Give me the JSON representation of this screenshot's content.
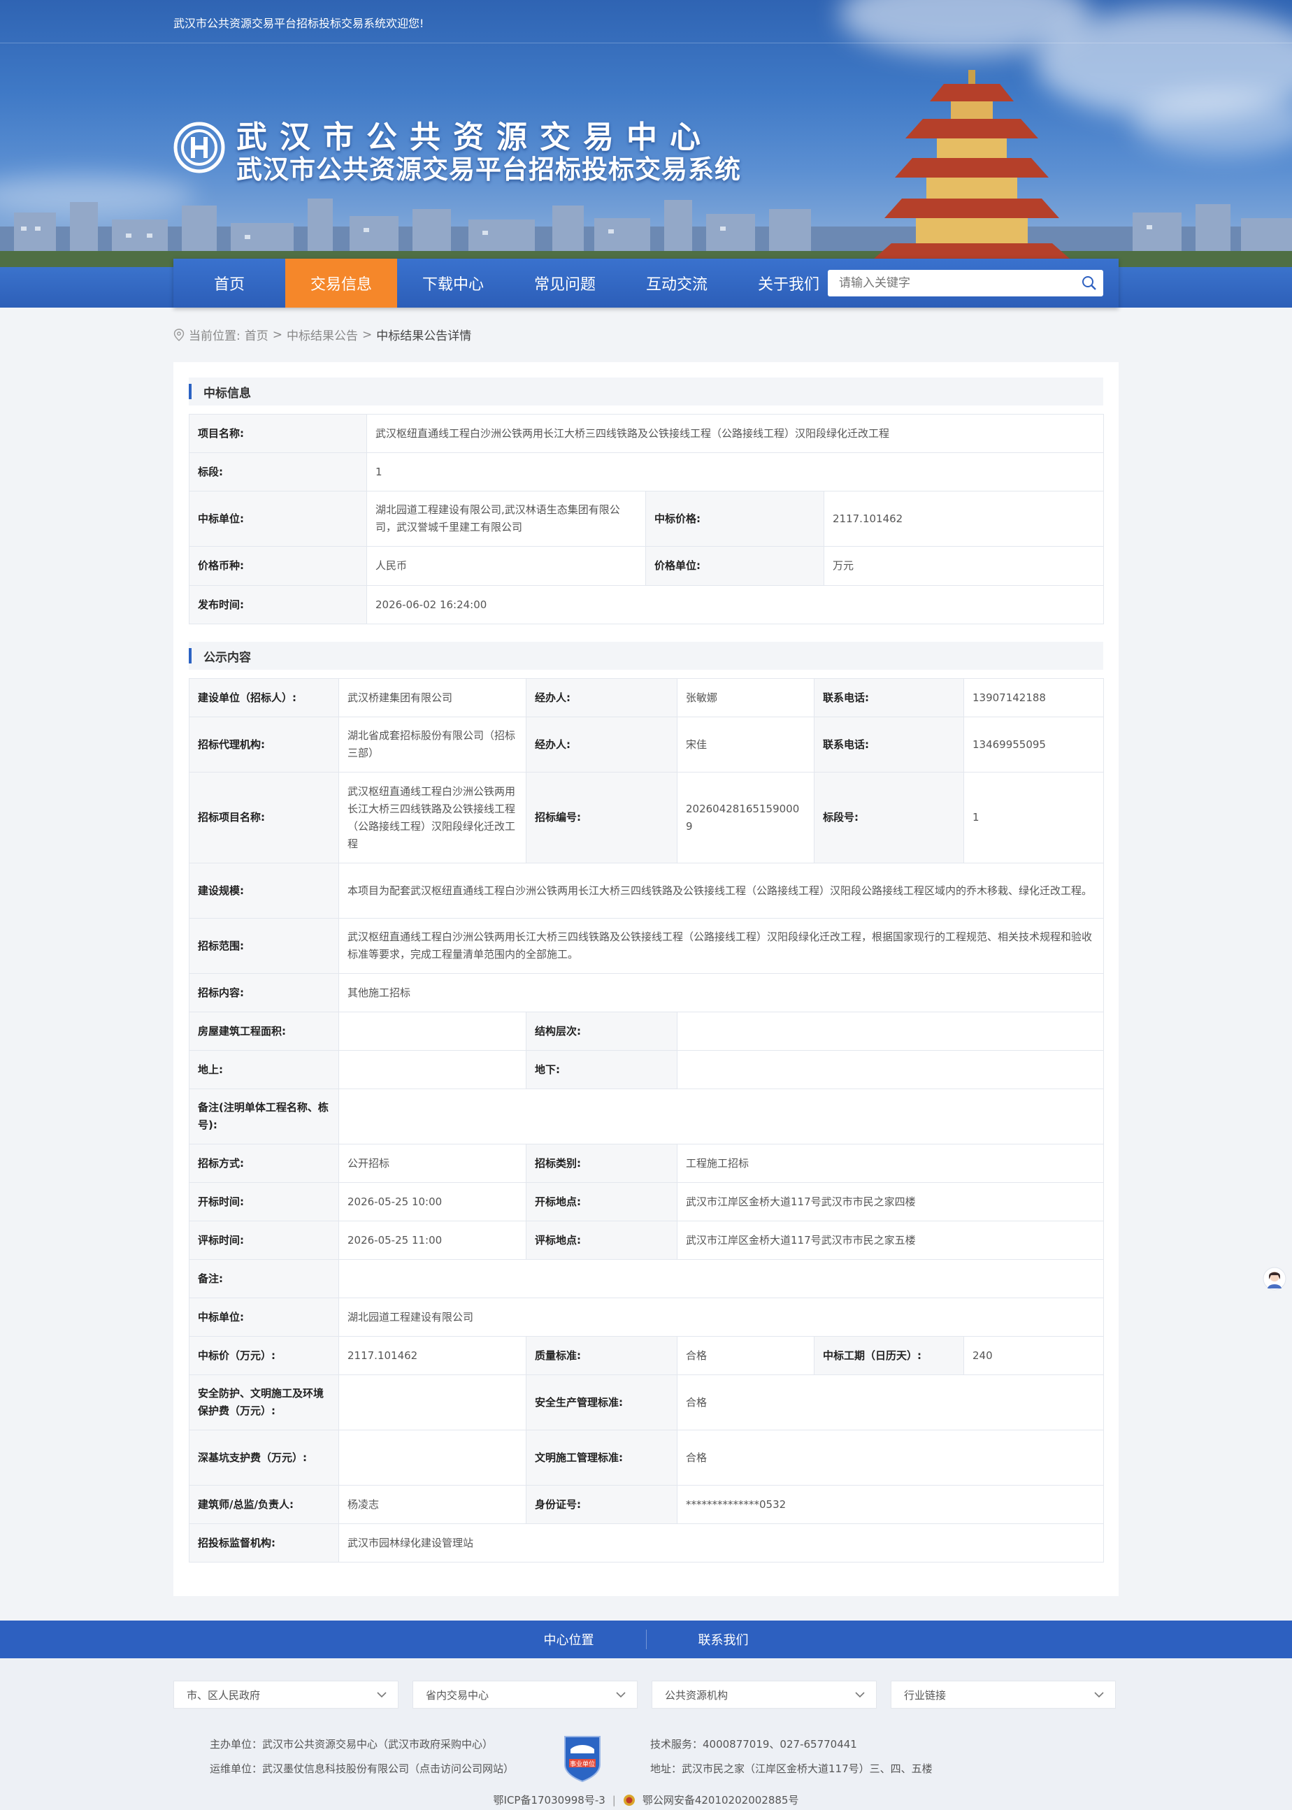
{
  "header": {
    "welcome": "武汉市公共资源交易平台招标投标交易系统欢迎您!",
    "title_main": "武汉市公共资源交易中心",
    "title_sub": "武汉市公共资源交易平台招标投标交易系统"
  },
  "nav": {
    "items": [
      "首页",
      "交易信息",
      "下载中心",
      "常见问题",
      "互动交流",
      "关于我们"
    ],
    "active_index": 1,
    "search_placeholder": "请输入关键字"
  },
  "breadcrumb": {
    "prefix": "当前位置:",
    "home": "首页",
    "sep": ">",
    "section": "中标结果公告",
    "current": "中标结果公告详情"
  },
  "award": {
    "heading": "中标信息",
    "project_name_label": "项目名称:",
    "project_name": "武汉枢纽直通线工程白沙洲公铁两用长江大桥三四线铁路及公铁接线工程（公路接线工程）汉阳段绿化迁改工程",
    "section_label": "标段:",
    "section": "1",
    "winner_label": "中标单位:",
    "winner": "湖北园道工程建设有限公司,武汉林语生态集团有限公司，武汉誉城千里建工有限公司",
    "price_label": "中标价格:",
    "price": "2117.101462",
    "currency_label": "价格币种:",
    "currency": "人民币",
    "unit_label": "价格单位:",
    "unit": "万元",
    "publish_label": "发布时间:",
    "publish": "2026-06-02 16:24:00"
  },
  "notice": {
    "heading": "公示内容",
    "builder_label": "建设单位（招标人）:",
    "builder": "武汉桥建集团有限公司",
    "handler_label": "经办人:",
    "handler1": "张敏娜",
    "phone_label": "联系电话:",
    "phone1": "13907142188",
    "agency_label": "招标代理机构:",
    "agency": "湖北省成套招标股份有限公司（招标三部）",
    "handler2": "宋佳",
    "phone2": "13469955095",
    "proj_label": "招标项目名称:",
    "proj": "武汉枢纽直通线工程白沙洲公铁两用长江大桥三四线铁路及公铁接线工程（公路接线工程）汉阳段绿化迁改工程",
    "code_label": "招标编号:",
    "code": "202604281651590009",
    "lot_label": "标段号:",
    "lot": "1",
    "scale_label": "建设规模:",
    "scale": "本项目为配套武汉枢纽直通线工程白沙洲公铁两用长江大桥三四线铁路及公铁接线工程（公路接线工程）汉阳段公路接线工程区域内的乔木移栽、绿化迁改工程。",
    "range_label": "招标范围:",
    "range": "武汉枢纽直通线工程白沙洲公铁两用长江大桥三四线铁路及公铁接线工程（公路接线工程）汉阳段绿化迁改工程，根据国家现行的工程规范、相关技术规程和验收标准等要求，完成工程量清单范围内的全部施工。",
    "content_label": "招标内容:",
    "content": "其他施工招标",
    "area_label": "房屋建筑工程面积:",
    "area": "",
    "struct_label": "结构层次:",
    "struct": "",
    "above_label": "地上:",
    "above": "",
    "below_label": "地下:",
    "below": "",
    "remark1_label": "备注(注明单体工程名称、栋号):",
    "remark1": "",
    "method_label": "招标方式:",
    "method": "公开招标",
    "category_label": "招标类别:",
    "category": "工程施工招标",
    "open_time_label": "开标时间:",
    "open_time": "2026-05-25 10:00",
    "open_place_label": "开标地点:",
    "open_place": "武汉市江岸区金桥大道117号武汉市市民之家四楼",
    "eval_time_label": "评标时间:",
    "eval_time": "2026-05-25 11:00",
    "eval_place_label": "评标地点:",
    "eval_place": "武汉市江岸区金桥大道117号武汉市市民之家五楼",
    "remark2_label": "备注:",
    "remark2": "",
    "winner_label": "中标单位:",
    "winner": "湖北园道工程建设有限公司",
    "price_label": "中标价（万元）:",
    "price": "2117.101462",
    "quality_label": "质量标准:",
    "quality": "合格",
    "period_label": "中标工期（日历天）:",
    "period": "240",
    "safety_fee_label": "安全防护、文明施工及环境保护费（万元）:",
    "safety_fee": "",
    "safety_std_label": "安全生产管理标准:",
    "safety_std": "合格",
    "pit_fee_label": "深基坑支护费（万元）:",
    "pit_fee": "",
    "civil_std_label": "文明施工管理标准:",
    "civil_std": "合格",
    "architect_label": "建筑师/总监/负责人:",
    "architect": "杨凌志",
    "id_label": "身份证号:",
    "id": "**************0532",
    "supervisor_label": "招投标监督机构:",
    "supervisor": "武汉市园林绿化建设管理站"
  },
  "footer": {
    "links": [
      "中心位置",
      "联系我们"
    ],
    "selects": [
      "市、区人民政府",
      "省内交易中心",
      "公共资源机构",
      "行业链接"
    ],
    "host": "主办单位：武汉市公共资源交易中心（武汉市政府采购中心）",
    "operator": "运维单位：武汉墨仗信息科技股份有限公司（点击访问公司网站）",
    "tech": "技术服务：4000877019、027-65770441",
    "address": "地址：武汉市民之家（江岸区金桥大道117号）三、四、五楼",
    "badge_text": "事业单位",
    "icp": "鄂ICP备17030998号-3",
    "police": "鄂公网安备42010202002885号"
  },
  "colors": {
    "primary": "#2d60c0",
    "active_tab": "#f5872a",
    "label_bg": "#f6f7f9",
    "border": "#e3e7ee"
  }
}
